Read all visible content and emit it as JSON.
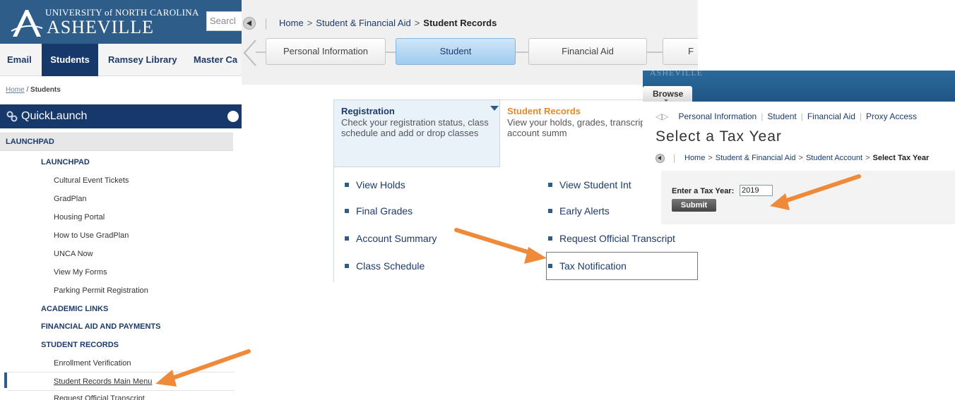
{
  "portal": {
    "logo": {
      "line1": "UNIVERSITY of NORTH CAROLINA",
      "line2": "ASHEVILLE"
    },
    "search_placeholder": "Searcl",
    "nav": [
      {
        "label": "Email",
        "active": false
      },
      {
        "label": "Students",
        "active": true
      },
      {
        "label": "Ramsey Library",
        "active": false
      },
      {
        "label": "Master Ca",
        "active": false
      }
    ],
    "breadcrumb": {
      "home": "Home",
      "sep": " / ",
      "current": "Students"
    },
    "quicklaunch": "QuickLaunch",
    "launchpad_header": "LAUNCHPAD",
    "sections": {
      "launchpad": "LAUNCHPAD",
      "academic": "ACADEMIC LINKS",
      "financial": "FINANCIAL AID AND PAYMENTS",
      "records": "STUDENT RECORDS"
    },
    "launchpad_links": [
      "Cultural Event Tickets",
      "GradPlan",
      "Housing Portal",
      "How to Use GradPlan",
      "UNCA Now",
      "View My Forms",
      "Parking Permit Registration"
    ],
    "records_links": [
      "Enrollment Verification",
      "Student Records Main Menu",
      "Request Official Transcript"
    ]
  },
  "records": {
    "breadcrumb": {
      "home": "Home",
      "financial": "Student & Financial Aid",
      "current": "Student Records",
      "sep": ">"
    },
    "tabs": [
      {
        "label": "Personal Information",
        "active": false
      },
      {
        "label": "Student",
        "active": true
      },
      {
        "label": "Financial Aid",
        "active": false
      },
      {
        "label": "F",
        "active": false
      }
    ],
    "registration": {
      "title": "Registration",
      "desc": "Check your registration status, class schedule and add or drop classes"
    },
    "student_records": {
      "title": "Student Records",
      "desc": "View your holds, grades, transcripts and account summ"
    },
    "menu_left": [
      "View Holds",
      "Final Grades",
      "Account Summary",
      "Class Schedule"
    ],
    "menu_right": [
      "View Student Int",
      "Early Alerts",
      "Request Official Transcript",
      "Tax Notification"
    ]
  },
  "tax": {
    "header_ghost": "ASHEVILLE",
    "browse": "Browse",
    "tabs": [
      "Personal Information",
      "Student",
      "Financial Aid",
      "Proxy Access"
    ],
    "title": "Select a Tax Year",
    "breadcrumb": {
      "home": "Home",
      "financial": "Student & Financial Aid",
      "account": "Student Account",
      "current": "Select Tax Year",
      "sep": ">"
    },
    "form": {
      "label": "Enter a Tax Year:",
      "value": "2019",
      "submit": "Submit"
    }
  },
  "colors": {
    "navy": "#16386b",
    "accent_blue": "#2f5d8a",
    "link_blue": "#1d3a6a",
    "orange": "#e38a2b",
    "arrow": "#ef8a3a"
  }
}
